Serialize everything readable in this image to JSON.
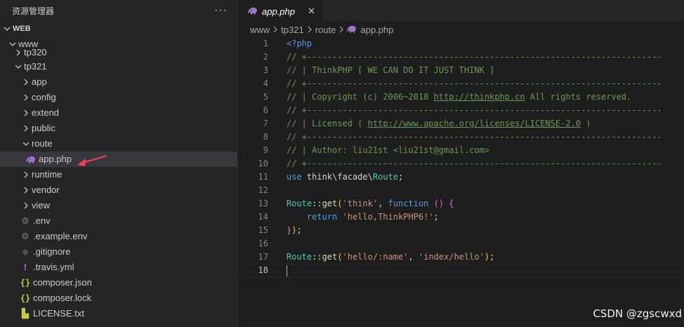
{
  "explorer": {
    "title": "资源管理器",
    "more": "···",
    "workspace": "WEB",
    "tree": {
      "www": "www",
      "tp320": "tp320",
      "tp321": "tp321",
      "app": "app",
      "config": "config",
      "extend": "extend",
      "public": "public",
      "route": "route",
      "app_php": "app.php",
      "runtime": "runtime",
      "vendor": "vendor",
      "view": "view",
      "env": ".env",
      "example_env": ".example.env",
      "gitignore": ".gitignore",
      "travis": ".travis.yml",
      "composer_json": "composer.json",
      "composer_lock": "composer.lock",
      "license": "LICENSE.txt"
    }
  },
  "editor": {
    "tab_label": "app.php",
    "tab_close": "✕",
    "breadcrumb": [
      "www",
      "tp321",
      "route",
      "app.php"
    ],
    "code": {
      "l1": "<?php",
      "l2": "// +----------------------------------------------------------------------",
      "l3": "// | ThinkPHP [ WE CAN DO IT JUST THINK ]",
      "l4": "// +----------------------------------------------------------------------",
      "l5a": "// | Copyright (c) 2006~2018 ",
      "l5link": "http://thinkphp.cn",
      "l5b": " All rights reserved.",
      "l6": "// +----------------------------------------------------------------------",
      "l7a": "// | Licensed ( ",
      "l7link": "http://www.apache.org/licenses/LICENSE-2.0",
      "l7b": " )",
      "l8": "// +----------------------------------------------------------------------",
      "l9": "// | Author: liu21st <liu21st@gmail.com>",
      "l10": "// +----------------------------------------------------------------------",
      "l11_use": "use",
      "l11_ns": " think\\facade\\",
      "l11_cls": "Route",
      "l11_end": ";",
      "route": "Route",
      "dcolon": "::",
      "get": "get",
      "open_paren": "(",
      "close_paren": ")",
      "l13_str": "'think'",
      "comma": ", ",
      "function_kw": "function",
      "l13_args": " () ",
      "open_brace": "{",
      "l14_indent": "    ",
      "return_kw": "return",
      "l14_str": " 'hello,ThinkPHP6!'",
      "semi": ";",
      "close_brace": "}",
      "l17_str1": "'hello/:name'",
      "l17_str2": "'index/hello'"
    },
    "line_numbers": [
      "1",
      "2",
      "3",
      "4",
      "5",
      "6",
      "7",
      "8",
      "9",
      "10",
      "11",
      "12",
      "13",
      "14",
      "15",
      "16",
      "17",
      "18"
    ]
  },
  "watermark": "CSDN @zgscwxd",
  "colors": {
    "accent_selection": "#37373d",
    "php_icon": "#a074c4",
    "annotation_arrow": "#e8455a"
  }
}
